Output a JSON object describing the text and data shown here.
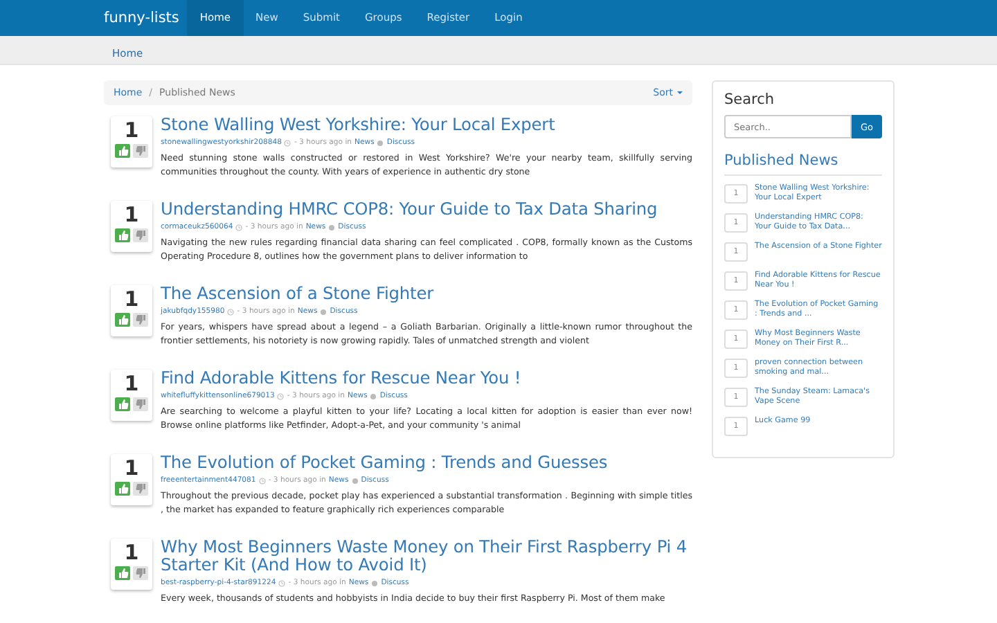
{
  "navbar": {
    "brand": "funny-lists",
    "items": [
      {
        "label": "Home",
        "selected": true
      },
      {
        "label": "New",
        "selected": false
      },
      {
        "label": "Submit",
        "selected": false
      },
      {
        "label": "Groups",
        "selected": false
      },
      {
        "label": "Register",
        "selected": false
      },
      {
        "label": "Login",
        "selected": false
      }
    ]
  },
  "subnav": {
    "label": "Home"
  },
  "breadcrumb": {
    "items": [
      "Home",
      "Published News"
    ],
    "separator": "/",
    "sort": "Sort"
  },
  "articles": [
    {
      "votes": "1",
      "title": "Stone Walling West Yorkshire: Your Local Expert",
      "author": "stonewallingwestyorkshir208848",
      "time": "- 3 hours ago in",
      "category": "News",
      "discuss": "Discuss",
      "body": "Need stunning stone walls constructed or restored in West Yorkshire? We're your nearby team, skillfully serving communities throughout the county. With years of experience in authentic dry stone"
    },
    {
      "votes": "1",
      "title": "Understanding HMRC COP8: Your Guide to Tax Data Sharing",
      "author": "cormaceukz560064",
      "time": "- 3 hours ago in",
      "category": "News",
      "discuss": "Discuss",
      "body": "Navigating the new rules regarding financial data sharing can feel complicated . COP8, formally known as the Customs Operating Procedure 8, outlines how the government plans to deliver information to"
    },
    {
      "votes": "1",
      "title": "The Ascension of a Stone Fighter",
      "author": "jakubfqdy155980",
      "time": "- 3 hours ago in",
      "category": "News",
      "discuss": "Discuss",
      "body": "For years, whispers have spread about a legend – a Goliath Barbarian. Originally a little-known rumor throughout the frontier settlements, his notoriety is now growing rapidly. Tales of unmatched strength and violent"
    },
    {
      "votes": "1",
      "title": "Find Adorable Kittens for Rescue Near You !",
      "author": "whitefluffykittensonline679013",
      "time": "- 3 hours ago in",
      "category": "News",
      "discuss": "Discuss",
      "body": "Are searching to welcome a playful kitten to your life? Locating a local kitten for adoption is easier than ever now! Browse online platforms like Petfinder, Adopt-a-Pet, and your community 's animal"
    },
    {
      "votes": "1",
      "title": "The Evolution of Pocket Gaming : Trends and Guesses",
      "author": "freeentertainment447081",
      "time": "- 3 hours ago in",
      "category": "News",
      "discuss": "Discuss",
      "body": "Throughout the previous decade, pocket play has experienced a substantial transformation . Beginning with simple titles , the market has expanded to feature graphically rich experiences comparable"
    },
    {
      "votes": "1",
      "title": "Why Most Beginners Waste Money on Their First Raspberry Pi 4 Starter Kit (And How to Avoid It)",
      "author": "best-raspberry-pi-4-star891224",
      "time": "- 3 hours ago in",
      "category": "News",
      "discuss": "Discuss",
      "body": "Every week, thousands of students and hobbyists in India decide to buy their first Raspberry Pi. Most of them make"
    }
  ],
  "sidebar": {
    "search_title": "Search",
    "search": {
      "placeholder": "Search.."
    },
    "go": "Go",
    "news_title": "Published News",
    "items": [
      {
        "count": "1",
        "title": "Stone Walling West Yorkshire: Your Local Expert"
      },
      {
        "count": "1",
        "title": "Understanding HMRC COP8: Your Guide to Tax Data..."
      },
      {
        "count": "1",
        "title": "The Ascension of a Stone Fighter"
      },
      {
        "count": "1",
        "title": "Find Adorable Kittens for Rescue Near You !"
      },
      {
        "count": "1",
        "title": "The Evolution of Pocket Gaming : Trends and ..."
      },
      {
        "count": "1",
        "title": "Why Most Beginners Waste Money on Their First R..."
      },
      {
        "count": "1",
        "title": "proven connection between smoking and mal..."
      },
      {
        "count": "1",
        "title": "The Sunday Steam: Lamaca's Vape Scene"
      },
      {
        "count": "1",
        "title": "Luck Game 99"
      }
    ]
  }
}
